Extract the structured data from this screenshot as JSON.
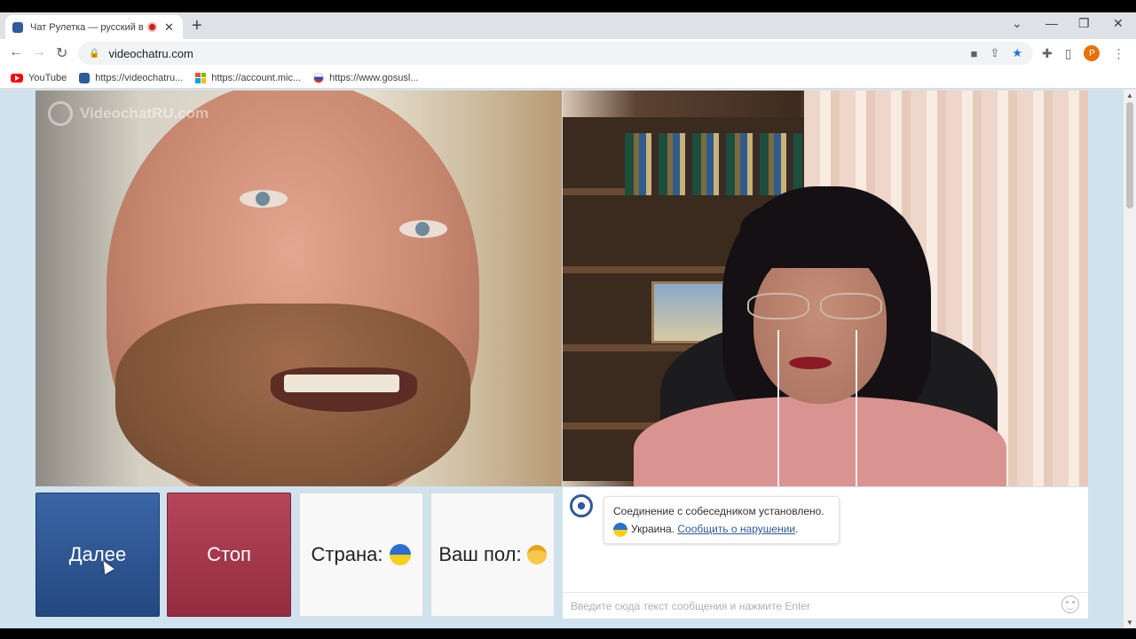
{
  "browser": {
    "tab_title": "Чат Рулетка — русский вид",
    "url": "videochatru.com",
    "profile_initial": "P",
    "bookmarks": [
      {
        "label": "YouTube",
        "icon": "youtube-icon"
      },
      {
        "label": "https://videochatru...",
        "icon": "videochat-icon"
      },
      {
        "label": "https://account.mic...",
        "icon": "microsoft-icon"
      },
      {
        "label": "https://www.gosusl...",
        "icon": "gosuslugi-icon"
      }
    ]
  },
  "page": {
    "watermark": "VideochatRU.com",
    "buttons": {
      "next": "Далее",
      "stop": "Стоп",
      "country": "Страна:",
      "gender": "Ваш пол:"
    },
    "chat": {
      "connected_msg": "Соединение с собеседником установлено.",
      "country_name": "Украина.",
      "report_link": "Сообщить о нарушении",
      "report_suffix": ".",
      "input_placeholder": "Введите сюда текст сообщения и нажмите Enter"
    }
  },
  "colors": {
    "accent_blue": "#2f5a9c",
    "stop_red": "#a53a4f",
    "page_bg": "#cfe2ee"
  }
}
